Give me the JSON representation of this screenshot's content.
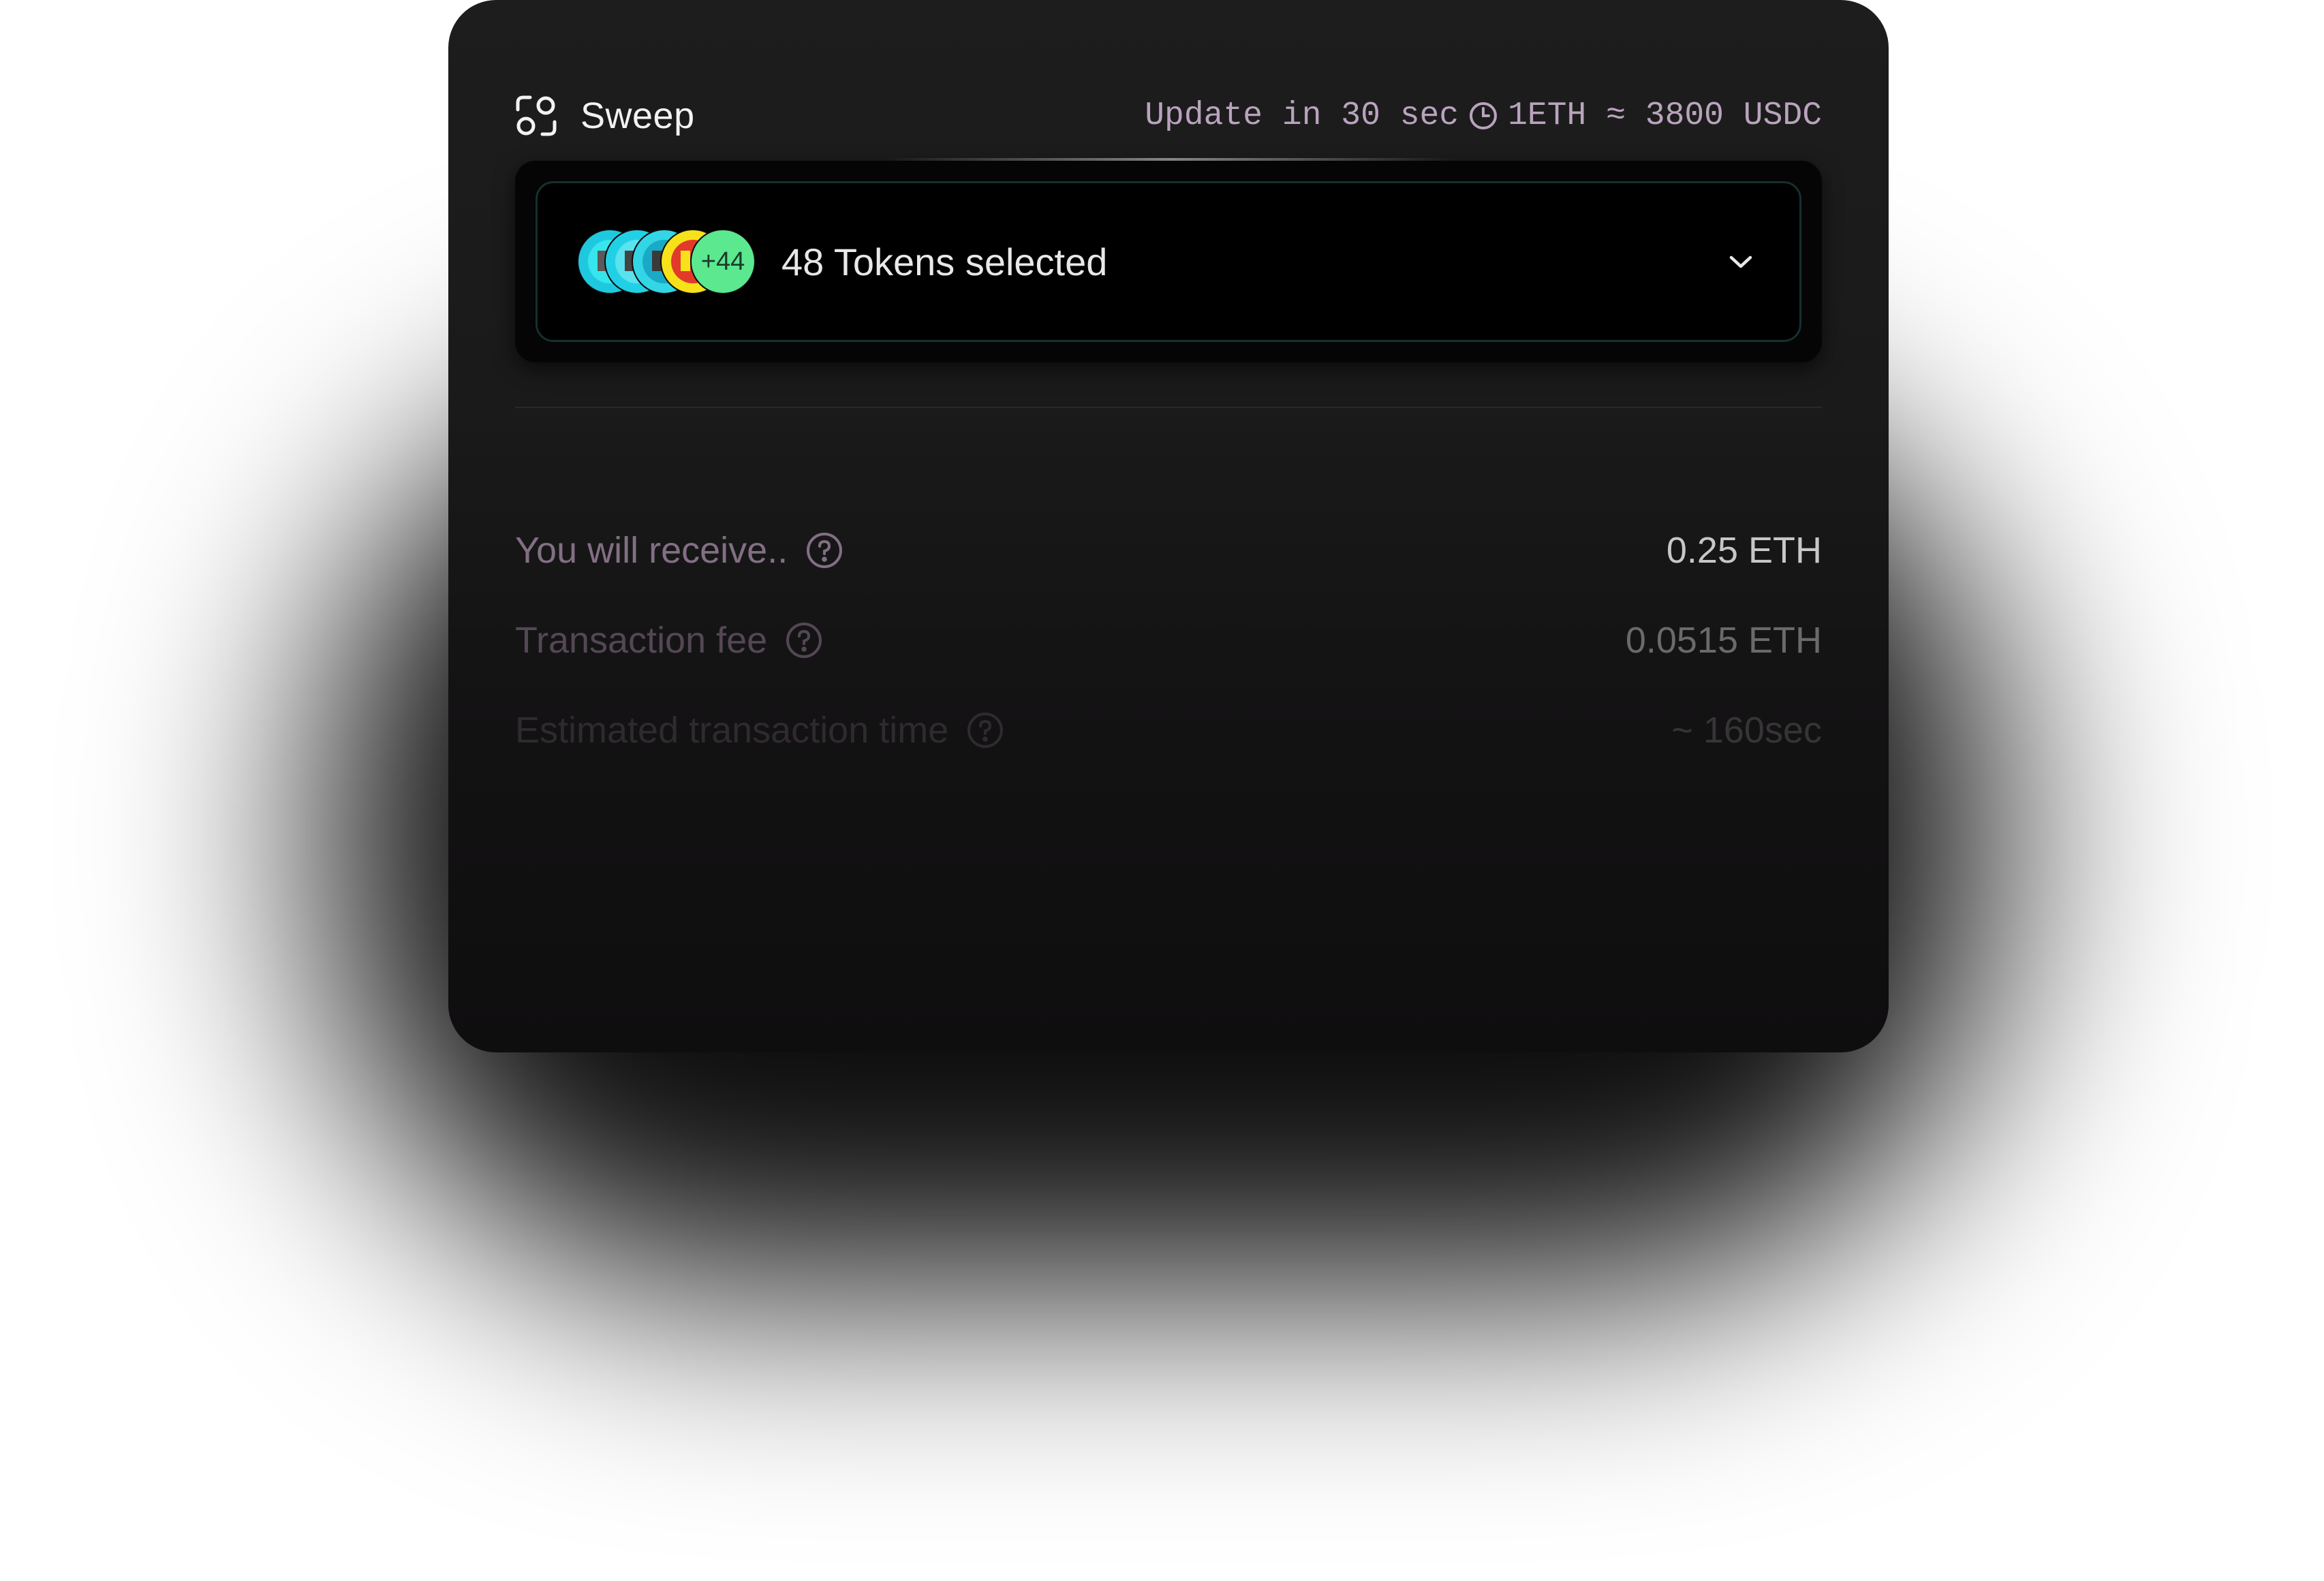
{
  "header": {
    "app_name": "Sweep",
    "update_text": "Update in 30 sec",
    "rate_text": "1ETH ≈ 3800 USDC"
  },
  "selector": {
    "label": "48 Tokens selected",
    "more_count": "+44",
    "token_colors": [
      "#1ec9e0",
      "#22d0e6",
      "#33d6e4",
      "#f7e21a"
    ]
  },
  "rows": [
    {
      "label": "You will receive..",
      "value": "0.25 ETH"
    },
    {
      "label": "Transaction fee",
      "value": "0.0515 ETH"
    },
    {
      "label": "Estimated transaction time",
      "value": "~ 160sec"
    }
  ],
  "icons": {
    "brand": "sweep-logo-icon",
    "clock": "clock-icon",
    "chevron": "chevron-down-icon",
    "help": "help-circle-icon"
  }
}
